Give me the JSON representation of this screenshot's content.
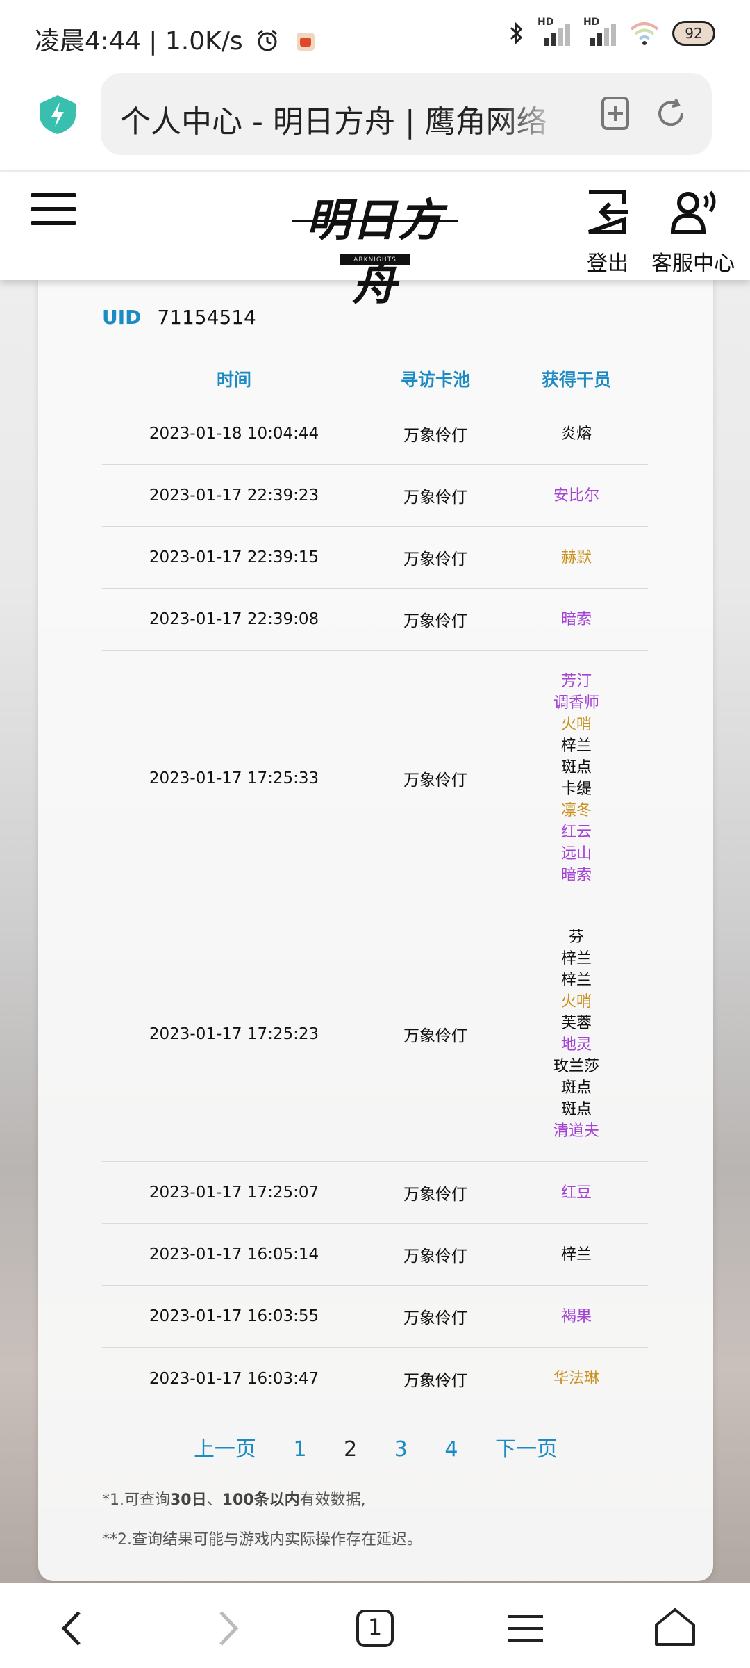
{
  "status_bar": {
    "time_text": "凌晨4:44 | 1.0K/s",
    "alarm_icon": "alarm-icon",
    "app_icon": "notification-app-icon",
    "bluetooth_icon": "bluetooth-icon",
    "signal1_label": "HD",
    "signal2_label": "HD",
    "wifi_icon": "wifi-icon",
    "battery": "92"
  },
  "browser": {
    "url_title": "个人中心 - 明日方舟 | 鹰角网络",
    "add_icon": "add-bookmark-icon",
    "reload_icon": "reload-icon"
  },
  "header": {
    "logo_text": "明日方舟",
    "logo_sub": "ARKNIGHTS",
    "logout_label": "登出",
    "service_label": "客服中心"
  },
  "account": {
    "uid_label": "UID",
    "uid_value": "71154514"
  },
  "table": {
    "headers": [
      "时间",
      "寻访卡池",
      "获得干员"
    ],
    "rows": [
      {
        "time": "2023-01-18 10:04:44",
        "pool": "万象伶仃",
        "ops": [
          {
            "name": "炎熔",
            "rarity": 3
          }
        ]
      },
      {
        "time": "2023-01-17 22:39:23",
        "pool": "万象伶仃",
        "ops": [
          {
            "name": "安比尔",
            "rarity": 4
          }
        ]
      },
      {
        "time": "2023-01-17 22:39:15",
        "pool": "万象伶仃",
        "ops": [
          {
            "name": "赫默",
            "rarity": 5
          }
        ]
      },
      {
        "time": "2023-01-17 22:39:08",
        "pool": "万象伶仃",
        "ops": [
          {
            "name": "暗索",
            "rarity": 4
          }
        ]
      },
      {
        "time": "2023-01-17 17:25:33",
        "pool": "万象伶仃",
        "ops": [
          {
            "name": "芳汀",
            "rarity": 4
          },
          {
            "name": "调香师",
            "rarity": 4
          },
          {
            "name": "火哨",
            "rarity": 5
          },
          {
            "name": "梓兰",
            "rarity": 3
          },
          {
            "name": "斑点",
            "rarity": 3
          },
          {
            "name": "卡缇",
            "rarity": 3
          },
          {
            "name": "凛冬",
            "rarity": 5
          },
          {
            "name": "红云",
            "rarity": 4
          },
          {
            "name": "远山",
            "rarity": 4
          },
          {
            "name": "暗索",
            "rarity": 4
          }
        ]
      },
      {
        "time": "2023-01-17 17:25:23",
        "pool": "万象伶仃",
        "ops": [
          {
            "name": "芬",
            "rarity": 3
          },
          {
            "name": "梓兰",
            "rarity": 3
          },
          {
            "name": "梓兰",
            "rarity": 3
          },
          {
            "name": "火哨",
            "rarity": 5
          },
          {
            "name": "芙蓉",
            "rarity": 3
          },
          {
            "name": "地灵",
            "rarity": 4
          },
          {
            "name": "玫兰莎",
            "rarity": 3
          },
          {
            "name": "斑点",
            "rarity": 3
          },
          {
            "name": "斑点",
            "rarity": 3
          },
          {
            "name": "清道夫",
            "rarity": 4
          }
        ]
      },
      {
        "time": "2023-01-17 17:25:07",
        "pool": "万象伶仃",
        "ops": [
          {
            "name": "红豆",
            "rarity": 4
          }
        ]
      },
      {
        "time": "2023-01-17 16:05:14",
        "pool": "万象伶仃",
        "ops": [
          {
            "name": "梓兰",
            "rarity": 3
          }
        ]
      },
      {
        "time": "2023-01-17 16:03:55",
        "pool": "万象伶仃",
        "ops": [
          {
            "name": "褐果",
            "rarity": 4
          }
        ]
      },
      {
        "time": "2023-01-17 16:03:47",
        "pool": "万象伶仃",
        "ops": [
          {
            "name": "华法琳",
            "rarity": 5
          }
        ]
      }
    ]
  },
  "pagination": {
    "prev": "上一页",
    "pages": [
      "1",
      "2",
      "3",
      "4"
    ],
    "current": "2",
    "next": "下一页"
  },
  "notes": {
    "n1_prefix": "*1.可查询",
    "n1_bold1": "30日",
    "n1_mid": "、",
    "n1_bold2": "100条以内",
    "n1_suffix": "有效数据,",
    "n2": "**2.查询结果可能与游戏内实际操作存在延迟。"
  },
  "bottom_nav": {
    "tab_count": "1",
    "icons": [
      "back-icon",
      "forward-icon",
      "tabs-icon",
      "menu-icon",
      "home-icon"
    ]
  }
}
